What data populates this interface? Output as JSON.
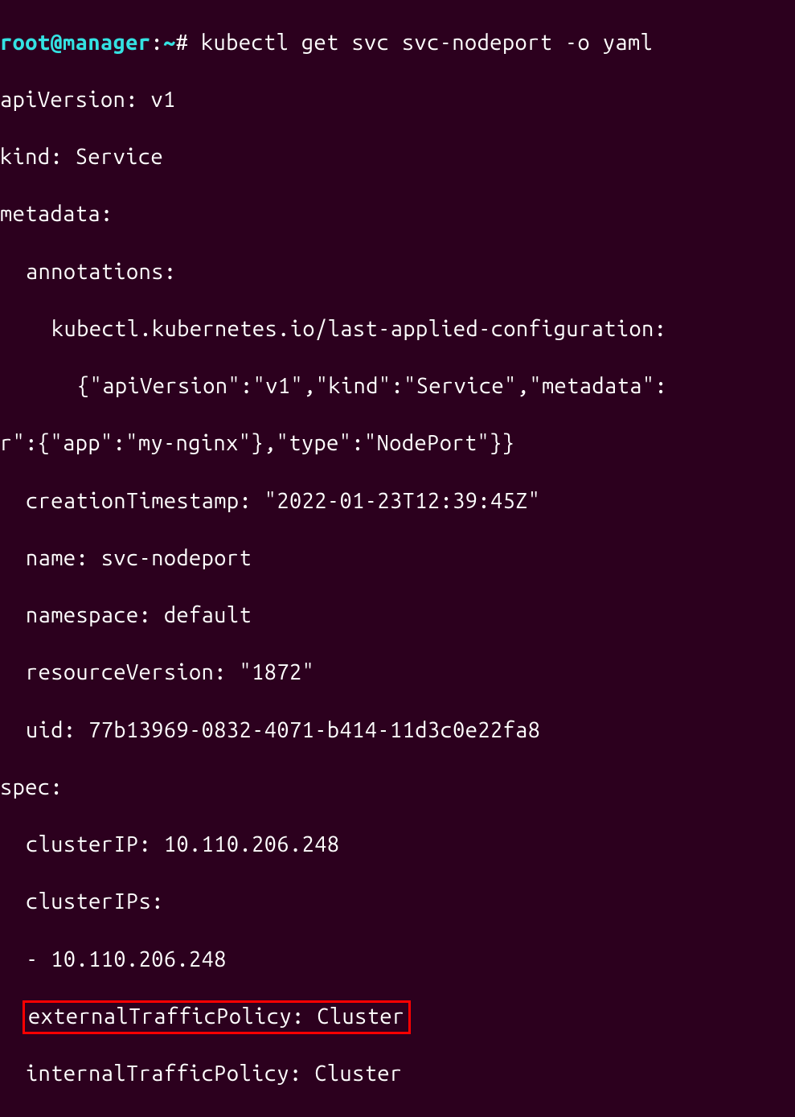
{
  "prompt": {
    "user_host": "root@manager",
    "separator": ":",
    "path": "~",
    "symbol": "# ",
    "command": "kubectl get svc svc-nodeport -o yaml"
  },
  "output": {
    "line1": "apiVersion: v1",
    "line2": "kind: Service",
    "line3": "metadata:",
    "line4": "annotations:",
    "line5": "kubectl.kubernetes.io/last-applied-configuration:",
    "line6": "{\"apiVersion\":\"v1\",\"kind\":\"Service\",\"metadata\":",
    "line7": "r\":{\"app\":\"my-nginx\"},\"type\":\"NodePort\"}}",
    "line8": "creationTimestamp: \"2022-01-23T12:39:45Z\"",
    "line9": "name: svc-nodeport",
    "line10": "namespace: default",
    "line11": "resourceVersion: \"1872\"",
    "line12": "uid: 77b13969-0832-4071-b414-11d3c0e22fa8",
    "line13": "spec:",
    "line14": "clusterIP: 10.110.206.248",
    "line15": "clusterIPs:",
    "line16": "- 10.110.206.248",
    "line17": "externalTrafficPolicy: Cluster",
    "line18": "internalTrafficPolicy: Cluster"
  }
}
